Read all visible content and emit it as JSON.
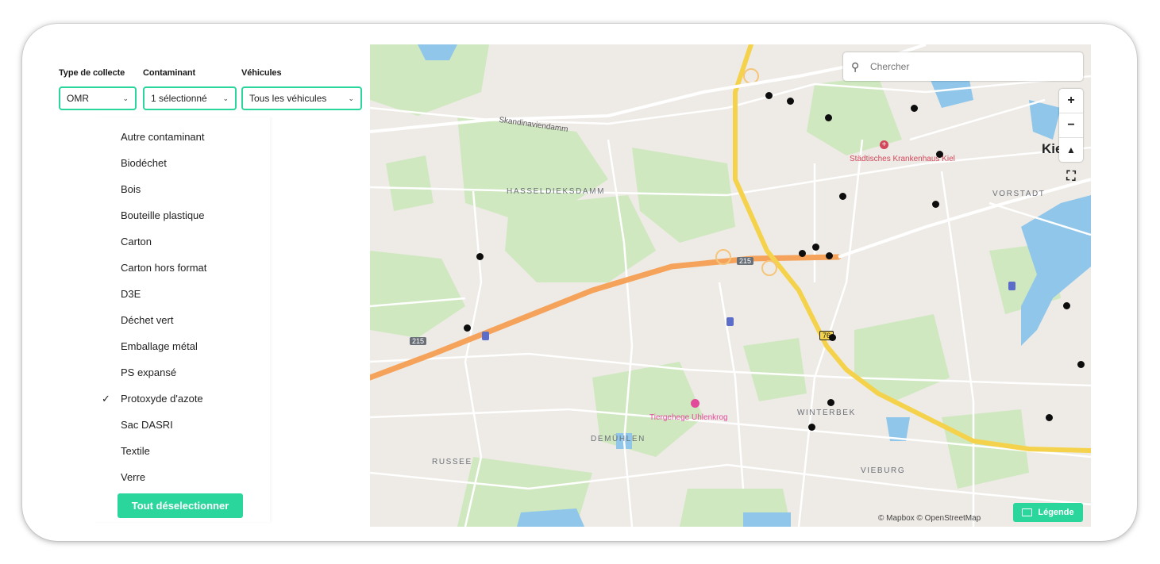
{
  "filters": {
    "collection_type": {
      "label": "Type de collecte",
      "value": "OMR"
    },
    "contaminant": {
      "label": "Contaminant",
      "value": "1 sélectionné"
    },
    "vehicles": {
      "label": "Véhicules",
      "value": "Tous les véhicules"
    }
  },
  "dropdown": {
    "options": [
      {
        "label": "Autre contaminant",
        "selected": false
      },
      {
        "label": "Biodéchet",
        "selected": false
      },
      {
        "label": "Bois",
        "selected": false
      },
      {
        "label": "Bouteille plastique",
        "selected": false
      },
      {
        "label": "Carton",
        "selected": false
      },
      {
        "label": "Carton hors format",
        "selected": false
      },
      {
        "label": "D3E",
        "selected": false
      },
      {
        "label": "Déchet vert",
        "selected": false
      },
      {
        "label": "Emballage métal",
        "selected": false
      },
      {
        "label": "PS expansé",
        "selected": false
      },
      {
        "label": "Protoxyde d'azote",
        "selected": true
      },
      {
        "label": "Sac DASRI",
        "selected": false
      },
      {
        "label": "Textile",
        "selected": false
      },
      {
        "label": "Verre",
        "selected": false
      }
    ],
    "checkmark": "✓",
    "deselect_label": "Tout déselectionner"
  },
  "map": {
    "search_placeholder": "Chercher",
    "zoom_in": "+",
    "zoom_out": "−",
    "compass": "▲",
    "fullscreen": "⛶",
    "attribution": "© Mapbox © OpenStreetMap",
    "legend_label": "Légende",
    "labels": {
      "hasseldieksdamm": "HASSELDIEKSDAMM",
      "vorstadt": "VORSTADT",
      "winterbek": "WINTERBEK",
      "demuhlen": "DEMÜHLEN",
      "russee": "RUSSEE",
      "vieburg": "VIEBURG",
      "skandinaviendamm": "Skandinaviendamm",
      "kiel_partial": "Kie",
      "hospital": "Städtisches Krankenhaus Kiel",
      "tiergehege": "Tiergehege Uhlenkrog",
      "road_215_a": "215",
      "road_215_b": "215",
      "road_76": "76"
    },
    "colors": {
      "accent": "#2bd69c",
      "motorway": "#f5a25a",
      "trunk": "#f4d24b",
      "park": "#cfe8c0",
      "water": "#8fc6ea",
      "marker": "#0d0d0d"
    }
  }
}
